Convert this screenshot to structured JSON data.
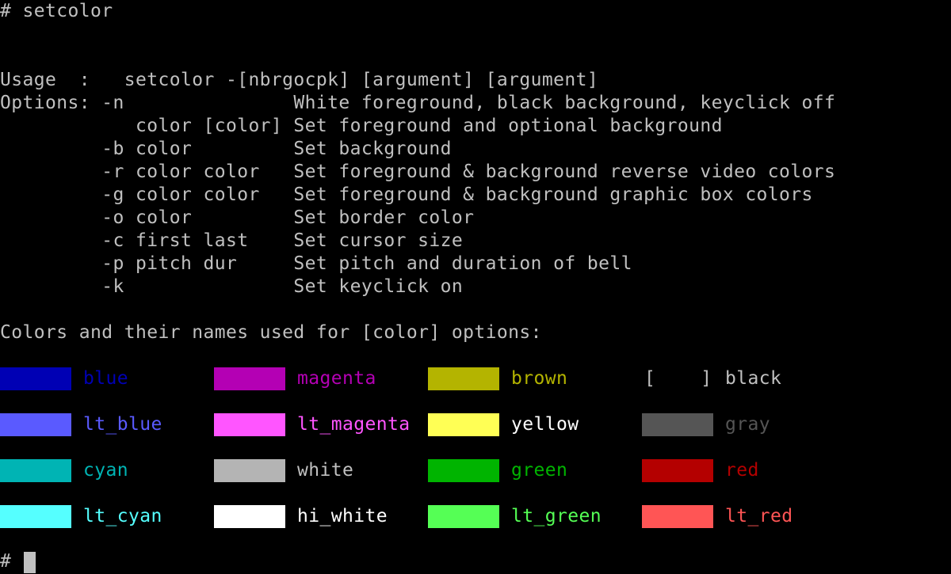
{
  "terminal": {
    "command_line": "# setcolor",
    "usage_line": "Usage  :   setcolor -[nbrgocpk] [argument] [argument]",
    "options": [
      "Options: -n               White foreground, black background, keyclick off",
      "            color [color] Set foreground and optional background",
      "         -b color         Set background",
      "         -r color color   Set foreground & background reverse video colors",
      "         -g color color   Set foreground & background graphic box colors",
      "         -o color         Set border color",
      "         -c first last    Set cursor size",
      "         -p pitch dur     Set pitch and duration of bell",
      "         -k               Set keyclick on"
    ],
    "colors_heading": "Colors and their names used for [color] options:",
    "black_bracket": "[    ]",
    "colors": [
      {
        "name": "blue",
        "swatch": "#0000b4",
        "text": "#0000b4"
      },
      {
        "name": "magenta",
        "swatch": "#b400b4",
        "text": "#b400b4"
      },
      {
        "name": "brown",
        "swatch": "#b4b400",
        "text": "#b4b400"
      },
      {
        "name": "black",
        "swatch": "",
        "text": "#c0c0c0"
      },
      {
        "name": "lt_blue",
        "swatch": "#5a5aff",
        "text": "#5a5aff"
      },
      {
        "name": "lt_magenta",
        "swatch": "#ff55ff",
        "text": "#ff55ff"
      },
      {
        "name": "yellow",
        "swatch": "#ffff55",
        "text": "#ffffff"
      },
      {
        "name": "gray",
        "swatch": "#555555",
        "text": "#555555"
      },
      {
        "name": "cyan",
        "swatch": "#00b4b4",
        "text": "#00b4b4"
      },
      {
        "name": "white",
        "swatch": "#b4b4b4",
        "text": "#c0c0c0"
      },
      {
        "name": "green",
        "swatch": "#00b400",
        "text": "#00b400"
      },
      {
        "name": "red",
        "swatch": "#b40000",
        "text": "#b40000"
      },
      {
        "name": "lt_cyan",
        "swatch": "#55ffff",
        "text": "#55ffff"
      },
      {
        "name": "hi_white",
        "swatch": "#ffffff",
        "text": "#ffffff"
      },
      {
        "name": "lt_green",
        "swatch": "#55ff55",
        "text": "#55ff55"
      },
      {
        "name": "lt_red",
        "swatch": "#ff5555",
        "text": "#ff5555"
      }
    ],
    "prompt": "#"
  }
}
